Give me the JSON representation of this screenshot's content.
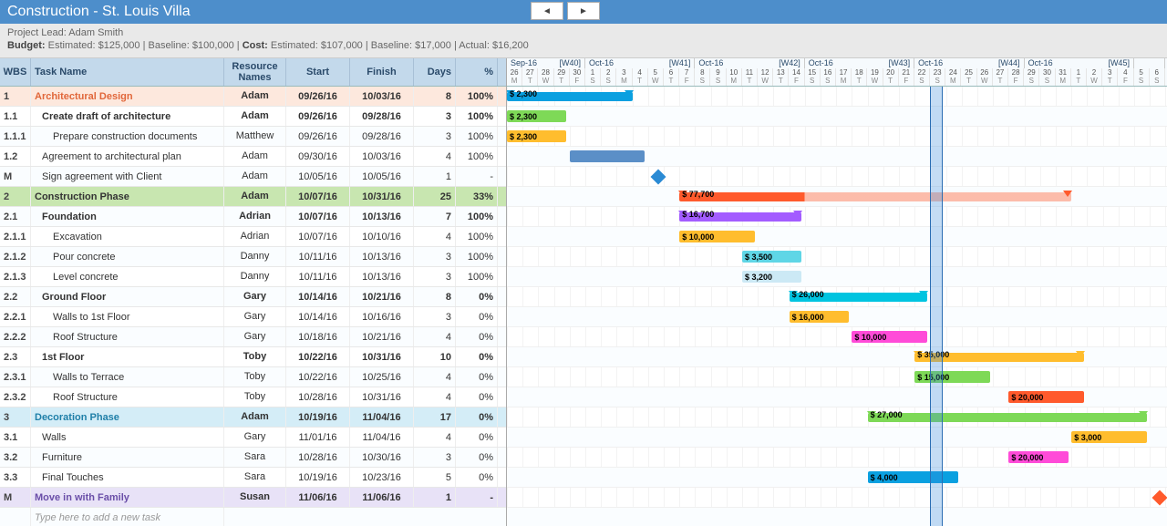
{
  "title": "Construction - St. Louis Villa",
  "project_lead_label": "Project Lead:",
  "project_lead": "Adam Smith",
  "budget_line": {
    "budget_label": "Budget:",
    "est_label": "Estimated:",
    "est_val": "$125,000",
    "base_label": "Baseline:",
    "base_val": "$100,000",
    "cost_label": "Cost:",
    "cost_est_label": "Estimated:",
    "cost_est_val": "$107,000",
    "cost_base_label": "Baseline:",
    "cost_base_val": "$17,000",
    "actual_label": "Actual:",
    "actual_val": "$16,200"
  },
  "columns": {
    "wbs": "WBS",
    "name": "Task Name",
    "res": "Resource Names",
    "start": "Start",
    "finish": "Finish",
    "days": "Days",
    "pct": "%"
  },
  "new_task_placeholder": "Type here to add a new task",
  "timeline": {
    "start_date": "2016-09-26",
    "weeks": [
      {
        "month": "Sep-16",
        "week": "[W40]",
        "span": 5
      },
      {
        "month": "Oct-16",
        "week": "[W41]",
        "span": 7
      },
      {
        "month": "Oct-16",
        "week": "[W42]",
        "span": 7
      },
      {
        "month": "Oct-16",
        "week": "[W43]",
        "span": 7
      },
      {
        "month": "Oct-16",
        "week": "[W44]",
        "span": 7
      },
      {
        "month": "Oct-16",
        "week": "[W45]",
        "span": 7
      },
      {
        "month": "",
        "week": "",
        "span": 2
      }
    ],
    "day_nums": [
      26,
      27,
      28,
      29,
      30,
      1,
      2,
      3,
      4,
      5,
      6,
      7,
      8,
      9,
      10,
      11,
      12,
      13,
      14,
      15,
      16,
      17,
      18,
      19,
      20,
      21,
      22,
      23,
      24,
      25,
      26,
      27,
      28,
      29,
      30,
      31,
      1,
      2,
      3,
      4,
      5,
      6
    ],
    "dows": [
      "M",
      "T",
      "W",
      "T",
      "F",
      "S",
      "S",
      "M",
      "T",
      "W",
      "T",
      "F",
      "S",
      "S",
      "M",
      "T",
      "W",
      "T",
      "F",
      "S",
      "S",
      "M",
      "T",
      "W",
      "T",
      "F",
      "S",
      "S",
      "M",
      "T",
      "W",
      "T",
      "F",
      "S",
      "S",
      "M",
      "T",
      "W",
      "T",
      "F",
      "S",
      "S"
    ]
  },
  "rows": [
    {
      "wbs": "1",
      "name": "Architectural Design",
      "res": "Adam",
      "start": "09/26/16",
      "finish": "10/03/16",
      "days": "8",
      "pct": "100%",
      "cls": "top-phase bold-row",
      "indent": 0,
      "bar": {
        "startDay": 0,
        "endDay": 7,
        "color": "#0aa0e0",
        "label": "$ 2,300",
        "type": "summary"
      }
    },
    {
      "wbs": "1.1",
      "name": "Create draft of architecture",
      "res": "Adam",
      "start": "09/26/16",
      "finish": "09/28/16",
      "days": "3",
      "pct": "100%",
      "cls": "bold-row",
      "indent": 1,
      "bar": {
        "startDay": 0,
        "endDay": 2.8,
        "color": "#7ed957",
        "label": "$ 2,300",
        "type": "task"
      }
    },
    {
      "wbs": "1.1.1",
      "name": "Prepare construction documents",
      "res": "Matthew",
      "start": "09/26/16",
      "finish": "09/28/16",
      "days": "3",
      "pct": "100%",
      "cls": "",
      "indent": 2,
      "bar": {
        "startDay": 0,
        "endDay": 2.8,
        "color": "#ffbd2e",
        "label": "$ 2,300",
        "type": "task"
      }
    },
    {
      "wbs": "1.2",
      "name": "Agreement to architectural plan",
      "res": "Adam",
      "start": "09/30/16",
      "finish": "10/03/16",
      "days": "4",
      "pct": "100%",
      "cls": "",
      "indent": 1,
      "bar": {
        "startDay": 4,
        "endDay": 7.8,
        "color": "#5b8fc7",
        "label": "",
        "type": "task"
      }
    },
    {
      "wbs": "M",
      "name": "Sign agreement with Client",
      "res": "Adam",
      "start": "10/05/16",
      "finish": "10/05/16",
      "days": "1",
      "pct": "-",
      "cls": "",
      "indent": 1,
      "milestone": {
        "day": 9.3,
        "color": "#2a8ad4"
      }
    },
    {
      "wbs": "2",
      "name": "Construction Phase",
      "res": "Adam",
      "start": "10/07/16",
      "finish": "10/31/16",
      "days": "25",
      "pct": "33%",
      "cls": "green-phase bold-row",
      "indent": 0,
      "bar": {
        "startDay": 11,
        "endDay": 35,
        "color": "#ff5a2c",
        "label": "$ 77,700",
        "type": "summary",
        "fadedFrom": 19
      }
    },
    {
      "wbs": "2.1",
      "name": "Foundation",
      "res": "Adrian",
      "start": "10/07/16",
      "finish": "10/13/16",
      "days": "7",
      "pct": "100%",
      "cls": "bold-row",
      "indent": 1,
      "bar": {
        "startDay": 11,
        "endDay": 17.8,
        "color": "#a35cff",
        "label": "$ 16,700",
        "type": "summary"
      }
    },
    {
      "wbs": "2.1.1",
      "name": "Excavation",
      "res": "Adrian",
      "start": "10/07/16",
      "finish": "10/10/16",
      "days": "4",
      "pct": "100%",
      "cls": "",
      "indent": 2,
      "bar": {
        "startDay": 11,
        "endDay": 14.8,
        "color": "#ffbd2e",
        "label": "$ 10,000",
        "type": "task"
      }
    },
    {
      "wbs": "2.1.2",
      "name": "Pour concrete",
      "res": "Danny",
      "start": "10/11/16",
      "finish": "10/13/16",
      "days": "3",
      "pct": "100%",
      "cls": "",
      "indent": 2,
      "bar": {
        "startDay": 15,
        "endDay": 17.8,
        "color": "#5fd6e6",
        "label": "$ 3,500",
        "type": "task"
      }
    },
    {
      "wbs": "2.1.3",
      "name": "Level concrete",
      "res": "Danny",
      "start": "10/11/16",
      "finish": "10/13/16",
      "days": "3",
      "pct": "100%",
      "cls": "",
      "indent": 2,
      "bar": {
        "startDay": 15,
        "endDay": 17.8,
        "color": "#cce9f5",
        "label": "$ 3,200",
        "type": "task"
      }
    },
    {
      "wbs": "2.2",
      "name": "Ground Floor",
      "res": "Gary",
      "start": "10/14/16",
      "finish": "10/21/16",
      "days": "8",
      "pct": "0%",
      "cls": "bold-row",
      "indent": 1,
      "bar": {
        "startDay": 18,
        "endDay": 25.8,
        "color": "#00c4e0",
        "label": "$ 26,000",
        "type": "summary"
      }
    },
    {
      "wbs": "2.2.1",
      "name": "Walls to 1st Floor",
      "res": "Gary",
      "start": "10/14/16",
      "finish": "10/16/16",
      "days": "3",
      "pct": "0%",
      "cls": "",
      "indent": 2,
      "bar": {
        "startDay": 18,
        "endDay": 20.8,
        "color": "#ffbd2e",
        "label": "$ 16,000",
        "type": "task"
      }
    },
    {
      "wbs": "2.2.2",
      "name": "Roof Structure",
      "res": "Gary",
      "start": "10/18/16",
      "finish": "10/21/16",
      "days": "4",
      "pct": "0%",
      "cls": "",
      "indent": 2,
      "bar": {
        "startDay": 22,
        "endDay": 25.8,
        "color": "#ff4bd8",
        "label": "$ 10,000",
        "type": "task"
      }
    },
    {
      "wbs": "2.3",
      "name": "1st Floor",
      "res": "Toby",
      "start": "10/22/16",
      "finish": "10/31/16",
      "days": "10",
      "pct": "0%",
      "cls": "bold-row",
      "indent": 1,
      "bar": {
        "startDay": 26,
        "endDay": 35.8,
        "color": "#ffbd2e",
        "label": "$ 35,000",
        "type": "summary"
      }
    },
    {
      "wbs": "2.3.1",
      "name": "Walls to Terrace",
      "res": "Toby",
      "start": "10/22/16",
      "finish": "10/25/16",
      "days": "4",
      "pct": "0%",
      "cls": "",
      "indent": 2,
      "bar": {
        "startDay": 26,
        "endDay": 29.8,
        "color": "#7ed957",
        "label": "$ 15,000",
        "type": "task"
      }
    },
    {
      "wbs": "2.3.2",
      "name": "Roof Structure",
      "res": "Toby",
      "start": "10/28/16",
      "finish": "10/31/16",
      "days": "4",
      "pct": "0%",
      "cls": "",
      "indent": 2,
      "bar": {
        "startDay": 32,
        "endDay": 35.8,
        "color": "#ff5a2c",
        "label": "$ 20,000",
        "type": "task"
      }
    },
    {
      "wbs": "3",
      "name": "Decoration Phase",
      "res": "Adam",
      "start": "10/19/16",
      "finish": "11/04/16",
      "days": "17",
      "pct": "0%",
      "cls": "blue-phase bold-row",
      "indent": 0,
      "bar": {
        "startDay": 23,
        "endDay": 39.8,
        "color": "#7ed957",
        "label": "$ 27,000",
        "type": "summary"
      }
    },
    {
      "wbs": "3.1",
      "name": "Walls",
      "res": "Gary",
      "start": "11/01/16",
      "finish": "11/04/16",
      "days": "4",
      "pct": "0%",
      "cls": "",
      "indent": 1,
      "bar": {
        "startDay": 36,
        "endDay": 39.8,
        "color": "#ffbd2e",
        "label": "$ 3,000",
        "type": "task"
      }
    },
    {
      "wbs": "3.2",
      "name": "Furniture",
      "res": "Sara",
      "start": "10/28/16",
      "finish": "10/30/16",
      "days": "3",
      "pct": "0%",
      "cls": "",
      "indent": 1,
      "bar": {
        "startDay": 32,
        "endDay": 34.8,
        "color": "#ff4bd8",
        "label": "$ 20,000",
        "type": "task"
      }
    },
    {
      "wbs": "3.3",
      "name": "Final Touches",
      "res": "Sara",
      "start": "10/19/16",
      "finish": "10/23/16",
      "days": "5",
      "pct": "0%",
      "cls": "",
      "indent": 1,
      "bar": {
        "startDay": 23,
        "endDay": 27.8,
        "color": "#0aa0e0",
        "label": "$ 4,000",
        "type": "task"
      }
    },
    {
      "wbs": "M",
      "name": "Move in with Family",
      "res": "Susan",
      "start": "11/06/16",
      "finish": "11/06/16",
      "days": "1",
      "pct": "-",
      "cls": "purple-phase bold-row",
      "indent": 0,
      "milestone": {
        "day": 41.3,
        "color": "#ff5a2c"
      }
    }
  ],
  "today_day_index": 27
}
